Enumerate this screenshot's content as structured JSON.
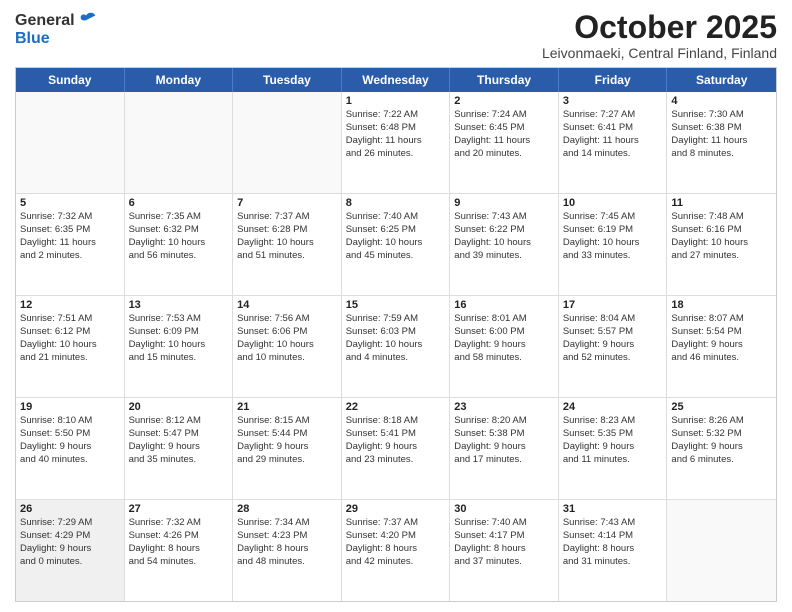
{
  "header": {
    "logo_general": "General",
    "logo_blue": "Blue",
    "title": "October 2025",
    "location": "Leivonmaeki, Central Finland, Finland"
  },
  "days_of_week": [
    "Sunday",
    "Monday",
    "Tuesday",
    "Wednesday",
    "Thursday",
    "Friday",
    "Saturday"
  ],
  "weeks": [
    [
      {
        "day": "",
        "lines": [],
        "empty": true
      },
      {
        "day": "",
        "lines": [],
        "empty": true
      },
      {
        "day": "",
        "lines": [],
        "empty": true
      },
      {
        "day": "1",
        "lines": [
          "Sunrise: 7:22 AM",
          "Sunset: 6:48 PM",
          "Daylight: 11 hours",
          "and 26 minutes."
        ]
      },
      {
        "day": "2",
        "lines": [
          "Sunrise: 7:24 AM",
          "Sunset: 6:45 PM",
          "Daylight: 11 hours",
          "and 20 minutes."
        ]
      },
      {
        "day": "3",
        "lines": [
          "Sunrise: 7:27 AM",
          "Sunset: 6:41 PM",
          "Daylight: 11 hours",
          "and 14 minutes."
        ]
      },
      {
        "day": "4",
        "lines": [
          "Sunrise: 7:30 AM",
          "Sunset: 6:38 PM",
          "Daylight: 11 hours",
          "and 8 minutes."
        ]
      }
    ],
    [
      {
        "day": "5",
        "lines": [
          "Sunrise: 7:32 AM",
          "Sunset: 6:35 PM",
          "Daylight: 11 hours",
          "and 2 minutes."
        ]
      },
      {
        "day": "6",
        "lines": [
          "Sunrise: 7:35 AM",
          "Sunset: 6:32 PM",
          "Daylight: 10 hours",
          "and 56 minutes."
        ]
      },
      {
        "day": "7",
        "lines": [
          "Sunrise: 7:37 AM",
          "Sunset: 6:28 PM",
          "Daylight: 10 hours",
          "and 51 minutes."
        ]
      },
      {
        "day": "8",
        "lines": [
          "Sunrise: 7:40 AM",
          "Sunset: 6:25 PM",
          "Daylight: 10 hours",
          "and 45 minutes."
        ]
      },
      {
        "day": "9",
        "lines": [
          "Sunrise: 7:43 AM",
          "Sunset: 6:22 PM",
          "Daylight: 10 hours",
          "and 39 minutes."
        ]
      },
      {
        "day": "10",
        "lines": [
          "Sunrise: 7:45 AM",
          "Sunset: 6:19 PM",
          "Daylight: 10 hours",
          "and 33 minutes."
        ]
      },
      {
        "day": "11",
        "lines": [
          "Sunrise: 7:48 AM",
          "Sunset: 6:16 PM",
          "Daylight: 10 hours",
          "and 27 minutes."
        ]
      }
    ],
    [
      {
        "day": "12",
        "lines": [
          "Sunrise: 7:51 AM",
          "Sunset: 6:12 PM",
          "Daylight: 10 hours",
          "and 21 minutes."
        ]
      },
      {
        "day": "13",
        "lines": [
          "Sunrise: 7:53 AM",
          "Sunset: 6:09 PM",
          "Daylight: 10 hours",
          "and 15 minutes."
        ]
      },
      {
        "day": "14",
        "lines": [
          "Sunrise: 7:56 AM",
          "Sunset: 6:06 PM",
          "Daylight: 10 hours",
          "and 10 minutes."
        ]
      },
      {
        "day": "15",
        "lines": [
          "Sunrise: 7:59 AM",
          "Sunset: 6:03 PM",
          "Daylight: 10 hours",
          "and 4 minutes."
        ]
      },
      {
        "day": "16",
        "lines": [
          "Sunrise: 8:01 AM",
          "Sunset: 6:00 PM",
          "Daylight: 9 hours",
          "and 58 minutes."
        ]
      },
      {
        "day": "17",
        "lines": [
          "Sunrise: 8:04 AM",
          "Sunset: 5:57 PM",
          "Daylight: 9 hours",
          "and 52 minutes."
        ]
      },
      {
        "day": "18",
        "lines": [
          "Sunrise: 8:07 AM",
          "Sunset: 5:54 PM",
          "Daylight: 9 hours",
          "and 46 minutes."
        ]
      }
    ],
    [
      {
        "day": "19",
        "lines": [
          "Sunrise: 8:10 AM",
          "Sunset: 5:50 PM",
          "Daylight: 9 hours",
          "and 40 minutes."
        ]
      },
      {
        "day": "20",
        "lines": [
          "Sunrise: 8:12 AM",
          "Sunset: 5:47 PM",
          "Daylight: 9 hours",
          "and 35 minutes."
        ]
      },
      {
        "day": "21",
        "lines": [
          "Sunrise: 8:15 AM",
          "Sunset: 5:44 PM",
          "Daylight: 9 hours",
          "and 29 minutes."
        ]
      },
      {
        "day": "22",
        "lines": [
          "Sunrise: 8:18 AM",
          "Sunset: 5:41 PM",
          "Daylight: 9 hours",
          "and 23 minutes."
        ]
      },
      {
        "day": "23",
        "lines": [
          "Sunrise: 8:20 AM",
          "Sunset: 5:38 PM",
          "Daylight: 9 hours",
          "and 17 minutes."
        ]
      },
      {
        "day": "24",
        "lines": [
          "Sunrise: 8:23 AM",
          "Sunset: 5:35 PM",
          "Daylight: 9 hours",
          "and 11 minutes."
        ]
      },
      {
        "day": "25",
        "lines": [
          "Sunrise: 8:26 AM",
          "Sunset: 5:32 PM",
          "Daylight: 9 hours",
          "and 6 minutes."
        ]
      }
    ],
    [
      {
        "day": "26",
        "lines": [
          "Sunrise: 7:29 AM",
          "Sunset: 4:29 PM",
          "Daylight: 9 hours",
          "and 0 minutes."
        ]
      },
      {
        "day": "27",
        "lines": [
          "Sunrise: 7:32 AM",
          "Sunset: 4:26 PM",
          "Daylight: 8 hours",
          "and 54 minutes."
        ]
      },
      {
        "day": "28",
        "lines": [
          "Sunrise: 7:34 AM",
          "Sunset: 4:23 PM",
          "Daylight: 8 hours",
          "and 48 minutes."
        ]
      },
      {
        "day": "29",
        "lines": [
          "Sunrise: 7:37 AM",
          "Sunset: 4:20 PM",
          "Daylight: 8 hours",
          "and 42 minutes."
        ]
      },
      {
        "day": "30",
        "lines": [
          "Sunrise: 7:40 AM",
          "Sunset: 4:17 PM",
          "Daylight: 8 hours",
          "and 37 minutes."
        ]
      },
      {
        "day": "31",
        "lines": [
          "Sunrise: 7:43 AM",
          "Sunset: 4:14 PM",
          "Daylight: 8 hours",
          "and 31 minutes."
        ]
      },
      {
        "day": "",
        "lines": [],
        "empty": true
      }
    ]
  ]
}
